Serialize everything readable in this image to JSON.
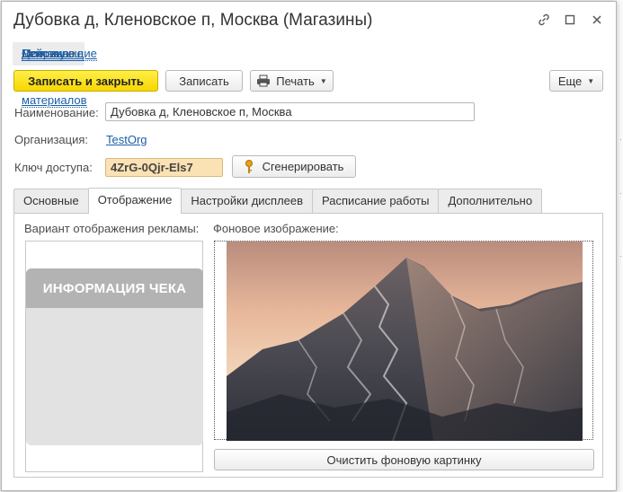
{
  "window": {
    "title": "Дубовка д, Кленовское п, Москва (Магазины)",
    "icons": [
      "link-icon",
      "maximize-icon",
      "close-icon"
    ]
  },
  "nav": {
    "tabs": [
      {
        "label": "Основное",
        "active": true
      },
      {
        "label": "Действующие опросы",
        "active": false
      },
      {
        "label": "Матрица размещения материалов",
        "active": false
      },
      {
        "label": "Рекламные дисплеи",
        "active": false
      }
    ]
  },
  "toolbar": {
    "save_close_label": "Записать и закрыть",
    "save_label": "Записать",
    "print_label": "Печать",
    "more_label": "Еще"
  },
  "form": {
    "name_label": "Наименование:",
    "name_value": "Дубовка д, Кленовское п, Москва",
    "org_label": "Организация:",
    "org_value": "TestOrg",
    "key_label": "Ключ доступа:",
    "key_value": "4ZrG-0Qjr-Els7",
    "generate_label": "Сгенерировать"
  },
  "tabs": [
    {
      "label": "Основные",
      "active": false
    },
    {
      "label": "Отображение",
      "active": true
    },
    {
      "label": "Настройки дисплеев",
      "active": false
    },
    {
      "label": "Расписание работы",
      "active": false
    },
    {
      "label": "Дополнительно",
      "active": false
    }
  ],
  "display": {
    "variant_label": "Вариант отображения рекламы:",
    "preview_text": "ИНФОРМАЦИЯ ЧЕКА",
    "background_label": "Фоновое изображение:",
    "clear_label": "Очистить фоновую картинку"
  },
  "colors": {
    "primary_button": "#f7d600",
    "link": "#1b5fa8",
    "key_field": "#fbe2b4"
  }
}
